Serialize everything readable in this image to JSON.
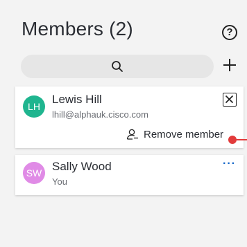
{
  "header": {
    "title": "Members (2)"
  },
  "icons": {
    "help": "question-circle-icon",
    "search": "search-icon",
    "add": "plus-icon",
    "close": "close-icon",
    "remove": "person-remove-icon",
    "more": "more-options-icon"
  },
  "labels": {
    "help_glyph": "?",
    "more_glyph": "···"
  },
  "members": [
    {
      "initials": "LH",
      "name": "Lewis Hill",
      "subtitle": "lhill@alphauk.cisco.com",
      "avatar_color": "#1fb58f",
      "action_label": "Remove member"
    },
    {
      "initials": "SW",
      "name": "Sally Wood",
      "subtitle": "You",
      "avatar_color": "#e08be6"
    }
  ],
  "colors": {
    "accent": "#1668c9",
    "pointer": "#e23b3b"
  }
}
